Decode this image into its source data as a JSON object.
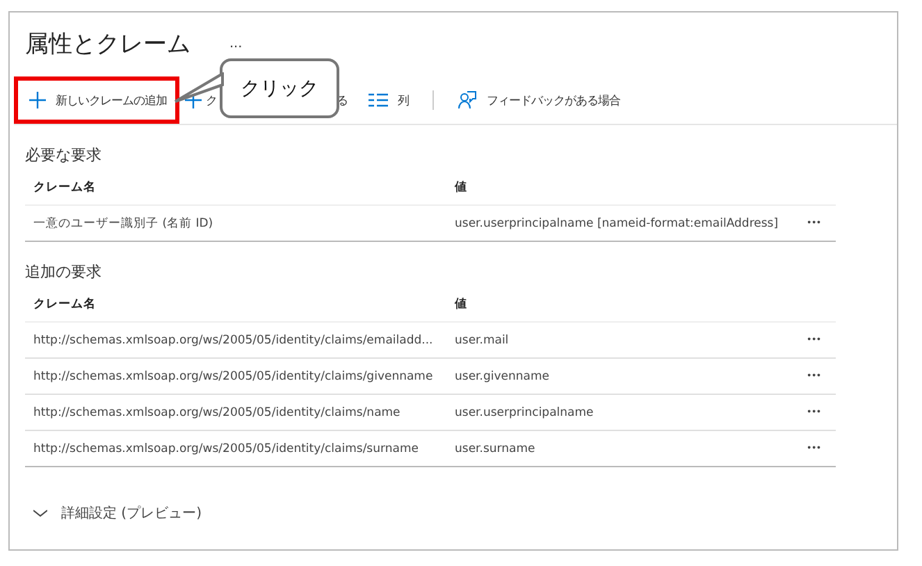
{
  "title": "属性とクレーム",
  "title_more": "...",
  "toolbar": [
    {
      "kind": "add",
      "label": "新しいクレームの追加",
      "highlighted": true
    },
    {
      "kind": "add",
      "label": "ク",
      "highlighted": false
    },
    {
      "kind": "fragment",
      "label": "る",
      "highlighted": false
    },
    {
      "kind": "columns",
      "label": "列",
      "highlighted": false
    },
    {
      "kind": "feedback",
      "label": "フィードバックがある場合",
      "highlighted": false
    }
  ],
  "callout": {
    "text": "クリック"
  },
  "sections": [
    {
      "heading": "必要な要求",
      "columns": [
        "クレーム名",
        "値"
      ],
      "rows": [
        {
          "name": "一意のユーザー識別子 (名前 ID)",
          "value": "user.userprincipalname [nameid-format:emailAddress]",
          "more": "•••"
        }
      ]
    },
    {
      "heading": "追加の要求",
      "columns": [
        "クレーム名",
        "値"
      ],
      "rows": [
        {
          "name": "http://schemas.xmlsoap.org/ws/2005/05/identity/claims/emailadd...",
          "value": "user.mail",
          "more": "•••"
        },
        {
          "name": "http://schemas.xmlsoap.org/ws/2005/05/identity/claims/givenname",
          "value": "user.givenname",
          "more": "•••"
        },
        {
          "name": "http://schemas.xmlsoap.org/ws/2005/05/identity/claims/name",
          "value": "user.userprincipalname",
          "more": "•••"
        },
        {
          "name": "http://schemas.xmlsoap.org/ws/2005/05/identity/claims/surname",
          "value": "user.surname",
          "more": "•••"
        }
      ]
    }
  ],
  "advanced": {
    "label": "詳細設定 (プレビュー)",
    "expanded": false
  }
}
